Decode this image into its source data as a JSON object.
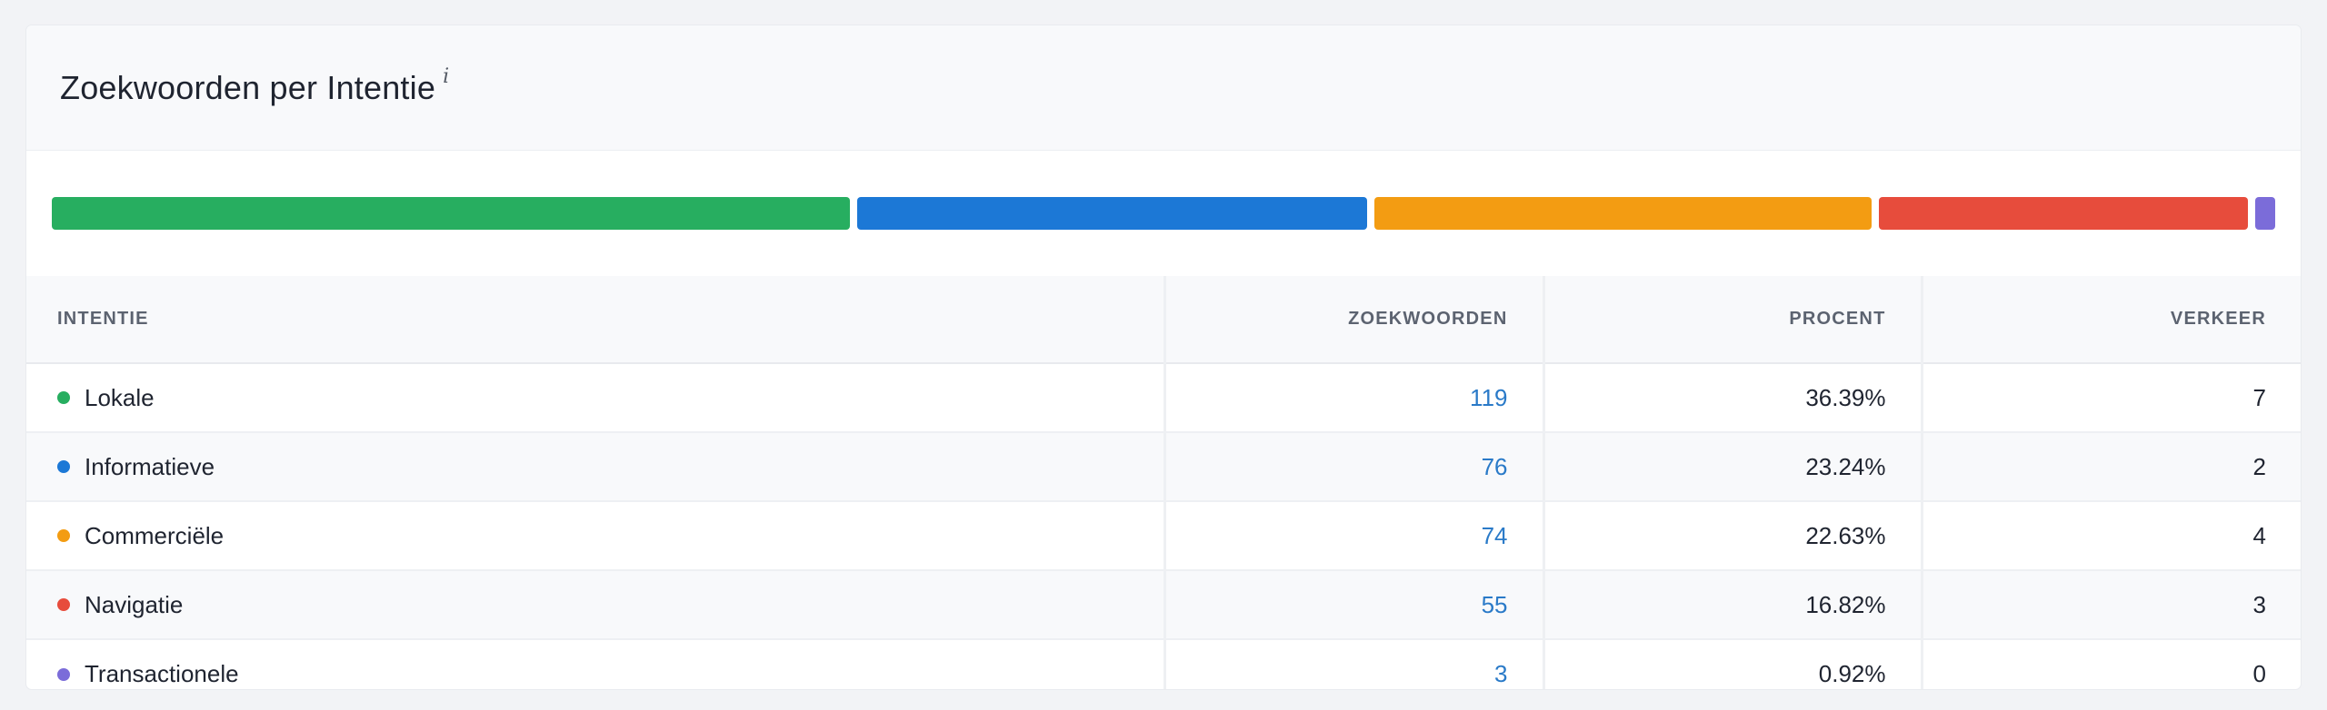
{
  "card": {
    "title": "Zoekwoorden per Intentie",
    "info_symbol": "i"
  },
  "distribution_bar": [
    {
      "name": "Lokale",
      "percent": 36.39,
      "color": "#27ae60"
    },
    {
      "name": "Informatieve",
      "percent": 23.24,
      "color": "#1c78d6"
    },
    {
      "name": "Commerciële",
      "percent": 22.63,
      "color": "#f39c12"
    },
    {
      "name": "Navigatie",
      "percent": 16.82,
      "color": "#e74c3c"
    },
    {
      "name": "Transactionele",
      "percent": 0.92,
      "color": "#7b6cd9"
    }
  ],
  "table": {
    "headers": {
      "intent": "Intentie",
      "keywords": "Zoekwoorden",
      "percent": "Procent",
      "traffic": "Verkeer"
    },
    "rows": [
      {
        "intent": "Lokale",
        "color": "#27ae60",
        "keywords": "119",
        "percent": "36.39%",
        "traffic": "7"
      },
      {
        "intent": "Informatieve",
        "color": "#1c78d6",
        "keywords": "76",
        "percent": "23.24%",
        "traffic": "2"
      },
      {
        "intent": "Commerciële",
        "color": "#f39c12",
        "keywords": "74",
        "percent": "22.63%",
        "traffic": "4"
      },
      {
        "intent": "Navigatie",
        "color": "#e74c3c",
        "keywords": "55",
        "percent": "16.82%",
        "traffic": "3"
      },
      {
        "intent": "Transactionele",
        "color": "#7b6cd9",
        "keywords": "3",
        "percent": "0.92%",
        "traffic": "0"
      }
    ]
  }
}
